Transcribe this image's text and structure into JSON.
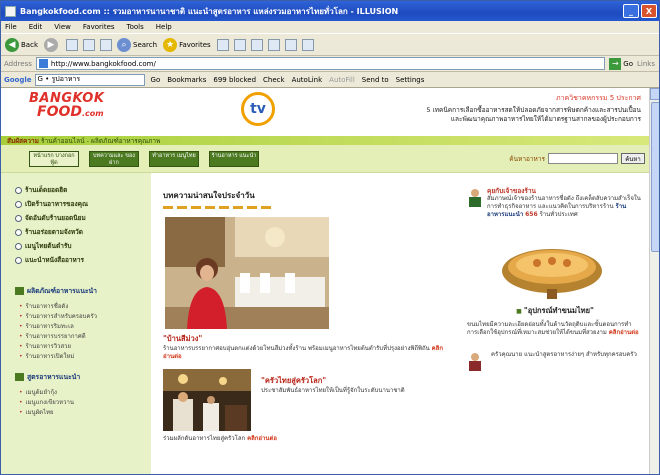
{
  "window": {
    "title": "Bangkokfood.com :: รวมอาหารนานาชาติ แนะนำสูตรอาหาร แหล่งรวมอาหารไทยทั่วโลก - ILLUSION",
    "min": "_",
    "close": "X"
  },
  "menu": [
    "File",
    "Edit",
    "View",
    "Favorites",
    "Tools",
    "Help"
  ],
  "toolbar": {
    "back": "Back",
    "search": "Search",
    "favorites": "Favorites"
  },
  "address": {
    "label": "Address",
    "url": "http://www.bangkokfood.com/",
    "go": "Go",
    "links": "Links"
  },
  "google": {
    "logo": "Google",
    "query": "G • รูปอาหาร",
    "go": "Go",
    "bookmarks": "Bookmarks",
    "blocked": "699 blocked",
    "check": "Check",
    "autolink": "AutoLink",
    "autofill": "AutoFill",
    "sendto": "Send to",
    "settings": "Settings"
  },
  "site": {
    "logo_top": "BANGKOK",
    "logo_bottom": "FOOD",
    "logo_suffix": ".com",
    "tv_logo": "tv",
    "header_red": "ภาควิชาคหกรรม 5 ประกาศ",
    "header_line1": "5 เทคนิคการเลือกซื้ออาหารสดให้ปลอดภัยจากสารพิษตกค้างและสารปนเปื้อน",
    "header_line2": "และพัฒนาคุณภาพอาหารไทยให้ได้มาตรฐานสากลของผู้ประกอบการ",
    "strip_bold": "สัมผัสความ",
    "strip_text": "ร้านค้าออนไลน์ - ผลิตภัณฑ์อาหารคุณภาพ",
    "nav": [
      "หน้าแรก บางกอกฟู้ด",
      "บทความและ ของฝาก",
      "ทำอาหาร เมนูไทย",
      "ร้านอาหาร แนะนำ"
    ],
    "search_label": "ค้นหาอาหาร",
    "search_button": "ค้นหา"
  },
  "left_menu": {
    "items": [
      "ร้านเด็ดยอดฮิต",
      "เปิดร้านอาหารของคุณ",
      "จัดอันดับร้านยอดนิยม",
      "ร้านอร่อยตามจังหวัด",
      "เมนูไทยต้นตำรับ",
      "แนะนำหนังสืออาหาร"
    ],
    "sec1_title": "ผลิตภัณฑ์อาหารแนะนำ",
    "sec1_items": [
      "ร้านอาหารชื่อดัง",
      "ร้านอาหารสำหรับครอบครัว",
      "ร้านอาหารริมทะเล",
      "ร้านอาหารบรรยากาศดี",
      "ร้านอาหารวิวสวย",
      "ร้านอาหารเปิดใหม่"
    ],
    "sec2_title": "สูตรอาหารแนะนำ",
    "sec2_items": [
      "เมนูต้มยำกุ้ง",
      "เมนูแกงเขียวหวาน",
      "เมนูผัดไทย"
    ]
  },
  "main": {
    "title": "บทความน่าสนใจประจำวัน",
    "art1_title": "\"บ้านสีม่วง\"",
    "art1_text": "ร้านอาหารบรรยากาศอบอุ่นตกแต่งด้วยโทนสีม่วงทั้งร้าน พร้อมเมนูอาหารไทยต้นตำรับที่ปรุงอย่างพิถีพิถัน",
    "art1_more": "คลิกอ่านต่อ",
    "art2_title": "\"ครัวไทยสู่ครัวโลก\"",
    "art2_text": "ประชาสัมพันธ์อาหารไทยให้เป็นที่รู้จักในระดับนานาชาติ",
    "art2_text2": "ร่วมผลักดันอาหารไทยสู่ครัวโลก",
    "art2_more": "คลิกอ่านต่อ"
  },
  "right": {
    "person_title": "คุยกับเจ้าของร้าน",
    "person_text": "สัมภาษณ์เจ้าของร้านอาหารชื่อดัง ถึงเคล็ดลับความสำเร็จในการทำธุรกิจอาหาร และแนวคิดในการบริหารร้าน",
    "person_link": "ร้านอาหารแนะนำ",
    "person_count": "656",
    "person_suffix": "ร้านทั่วประเทศ",
    "food_title": "\"อุปกรณ์ทำขนมไทย\"",
    "food_text": "ขนมไทยมีความละเอียดอ่อนทั้งในด้านวัตถุดิบและขั้นตอนการทำ การเลือกใช้อุปกรณ์ที่เหมาะสมช่วยให้ได้ขนมที่สวยงาม",
    "food_more": "คลิกอ่านต่อ",
    "bottom_text": "ครัวคุณนาย แนะนำสูตรอาหารง่ายๆ สำหรับทุกครอบครัว"
  }
}
